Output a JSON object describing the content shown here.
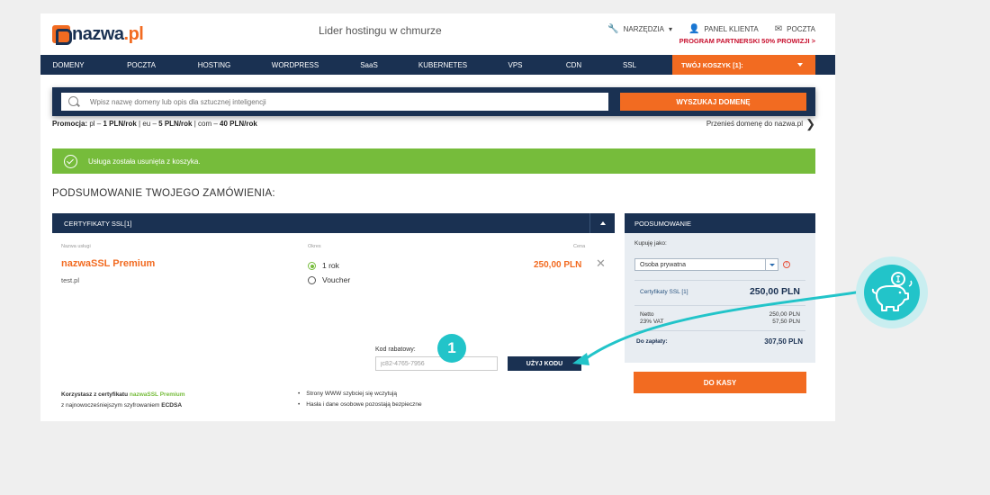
{
  "header": {
    "logo_main": "nazwa",
    "logo_tld": ".pl",
    "tagline": "Lider hostingu w chmurze",
    "tools_label": "NARZĘDZIA",
    "client_panel": "PANEL KLIENTA",
    "mail": "POCZTA",
    "partner_program": "PROGRAM PARTNERSKI 50% PROWIZJI >"
  },
  "nav": {
    "items": [
      "DOMENY",
      "POCZTA",
      "HOSTING",
      "WORDPRESS",
      "SaaS",
      "KUBERNETES",
      "VPS",
      "CDN",
      "SSL"
    ],
    "cart": "TWÓJ KOSZYK [1]:"
  },
  "search": {
    "placeholder": "Wpisz nazwę domeny lub opis dla sztucznej inteligencji",
    "button": "WYSZUKAJ DOMENĘ"
  },
  "promo": {
    "label": "Promocja:",
    "pl_prefix": " pl – ",
    "pl_price": "1 PLN/rok",
    "eu_prefix": " | eu – ",
    "eu_price": "5 PLN/rok",
    "com_prefix": " | com – ",
    "com_price": "40 PLN/rok",
    "transfer": "Przenieś domenę do nazwa.pl"
  },
  "alert": {
    "message": "Usługa została usunięta z koszyka."
  },
  "order": {
    "title": "PODSUMOWANIE TWOJEGO ZAMÓWIENIA:",
    "section": "CERTYFIKATY SSL[1]",
    "col_service": "Nazwa usługi",
    "col_period": "Okres",
    "col_price": "Cena",
    "service_name": "nazwaSSL Premium",
    "service_domain": "test.pl",
    "option_1": "1 rok",
    "option_2": "Voucher",
    "price": "250,00 PLN",
    "coupon_label": "Kod rabatowy:",
    "coupon_value": "jc82-4765-7956",
    "coupon_button": "UŻYJ KODU",
    "note_prefix": "Korzystasz z certyfikatu ",
    "note_product": "nazwaSSL Premium",
    "note_line2_prefix": "z najnowocześniejszym szyfrowaniem ",
    "note_line2_strong": "ECDSA",
    "benefits": [
      "Strony WWW szybciej się wczytują",
      "Hasła i dane osobowe pozostają bezpieczne"
    ]
  },
  "summary": {
    "title": "PODSUMOWANIE",
    "buy_as_label": "Kupuję jako:",
    "buy_as_value": "Osoba prywatna",
    "item_label": "Certyfikaty SSL [1]",
    "item_price": "250,00 PLN",
    "netto_label": "Netto",
    "netto_value": "250,00 PLN",
    "vat_label": "23% VAT",
    "vat_value": "57,50 PLN",
    "total_label": "Do zapłaty:",
    "total_value": "307,50 PLN",
    "checkout": "DO KASY"
  },
  "annotation": {
    "step": "1",
    "accent": "#22c4c9"
  },
  "colors": {
    "navy": "#1a3152",
    "orange": "#f26b21",
    "green": "#76bc3b"
  }
}
